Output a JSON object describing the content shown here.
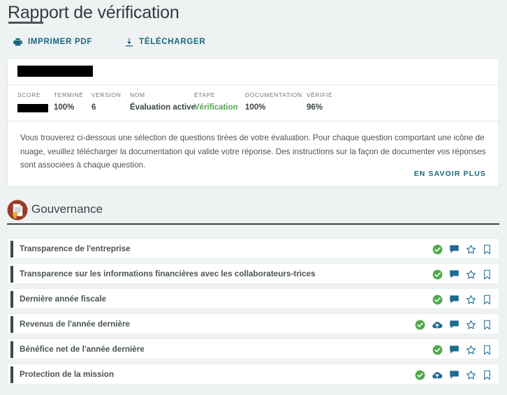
{
  "header": {
    "title": "Rapport de vérification",
    "actions": [
      {
        "label": "IMPRIMER PDF",
        "icon": "printer-icon"
      },
      {
        "label": "TÉLÉCHARGER",
        "icon": "download-icon"
      }
    ]
  },
  "org": {
    "name_redacted": true
  },
  "meta": {
    "columns": [
      {
        "key": "score",
        "label": "SCORE",
        "value": "",
        "redacted": true,
        "color": "#3b4446"
      },
      {
        "key": "termine",
        "label": "TERMINÉ",
        "value": "100%",
        "redacted": false,
        "color": "#3b4446"
      },
      {
        "key": "version",
        "label": "VERSION",
        "value": "6",
        "redacted": false,
        "color": "#3b4446"
      },
      {
        "key": "nom",
        "label": "NOM",
        "value": "Évaluation active",
        "redacted": false,
        "color": "#3b4446"
      },
      {
        "key": "etape",
        "label": "ÉTAPE",
        "value": "Vérification",
        "redacted": false,
        "color": "#5aa552"
      },
      {
        "key": "documentation",
        "label": "DOCUMENTATION",
        "value": "100%",
        "redacted": false,
        "color": "#3b4446"
      },
      {
        "key": "verifie",
        "label": "VÉRIFIÉ",
        "value": "96%",
        "redacted": false,
        "color": "#3b4446"
      }
    ]
  },
  "intro": {
    "text": "Vous trouverez ci-dessous une sélection de questions tirées de votre évaluation. Pour chaque question comportant une icône de nuage, veuillez télécharger la documentation qui valide votre réponse. Des instructions sur la façon de documenter vos réponses sont associées à chaque question.",
    "learn_more": "EN SAVOIR PLUS"
  },
  "section": {
    "icon": "certificate-document-icon",
    "icon_color": "#9b3a27",
    "title": "Gouvernance"
  },
  "questions": [
    {
      "label": "Transparence de l'entreprise",
      "icons": [
        "verified-check-icon",
        "comment-icon",
        "star-icon",
        "bookmark-icon"
      ]
    },
    {
      "label": "Transparence sur les informations financières avec les collaborateurs-trices",
      "icons": [
        "verified-check-icon",
        "comment-icon",
        "star-icon",
        "bookmark-icon"
      ]
    },
    {
      "label": "Dernière année fiscale",
      "icons": [
        "verified-check-icon",
        "comment-icon",
        "star-icon",
        "bookmark-icon"
      ]
    },
    {
      "label": "Revenus de l'année dernière",
      "icons": [
        "verified-check-icon",
        "cloud-upload-icon",
        "comment-icon",
        "star-icon",
        "bookmark-icon"
      ]
    },
    {
      "label": "Bénéfice net de l'année dernière",
      "icons": [
        "verified-check-icon",
        "comment-icon",
        "star-icon",
        "bookmark-icon"
      ]
    },
    {
      "label": "Protection de la mission",
      "icons": [
        "verified-check-icon",
        "cloud-upload-icon",
        "comment-icon",
        "star-icon",
        "bookmark-icon"
      ]
    }
  ],
  "colors": {
    "page_bg": "#eef2f3",
    "card_bg": "#ffffff",
    "accent_link": "#17667d",
    "status_green": "#5aa552",
    "check_green": "#4fa94d",
    "icon_blue": "#1f6a91",
    "text_dark": "#3b4446",
    "row_accent": "#3e484a"
  }
}
